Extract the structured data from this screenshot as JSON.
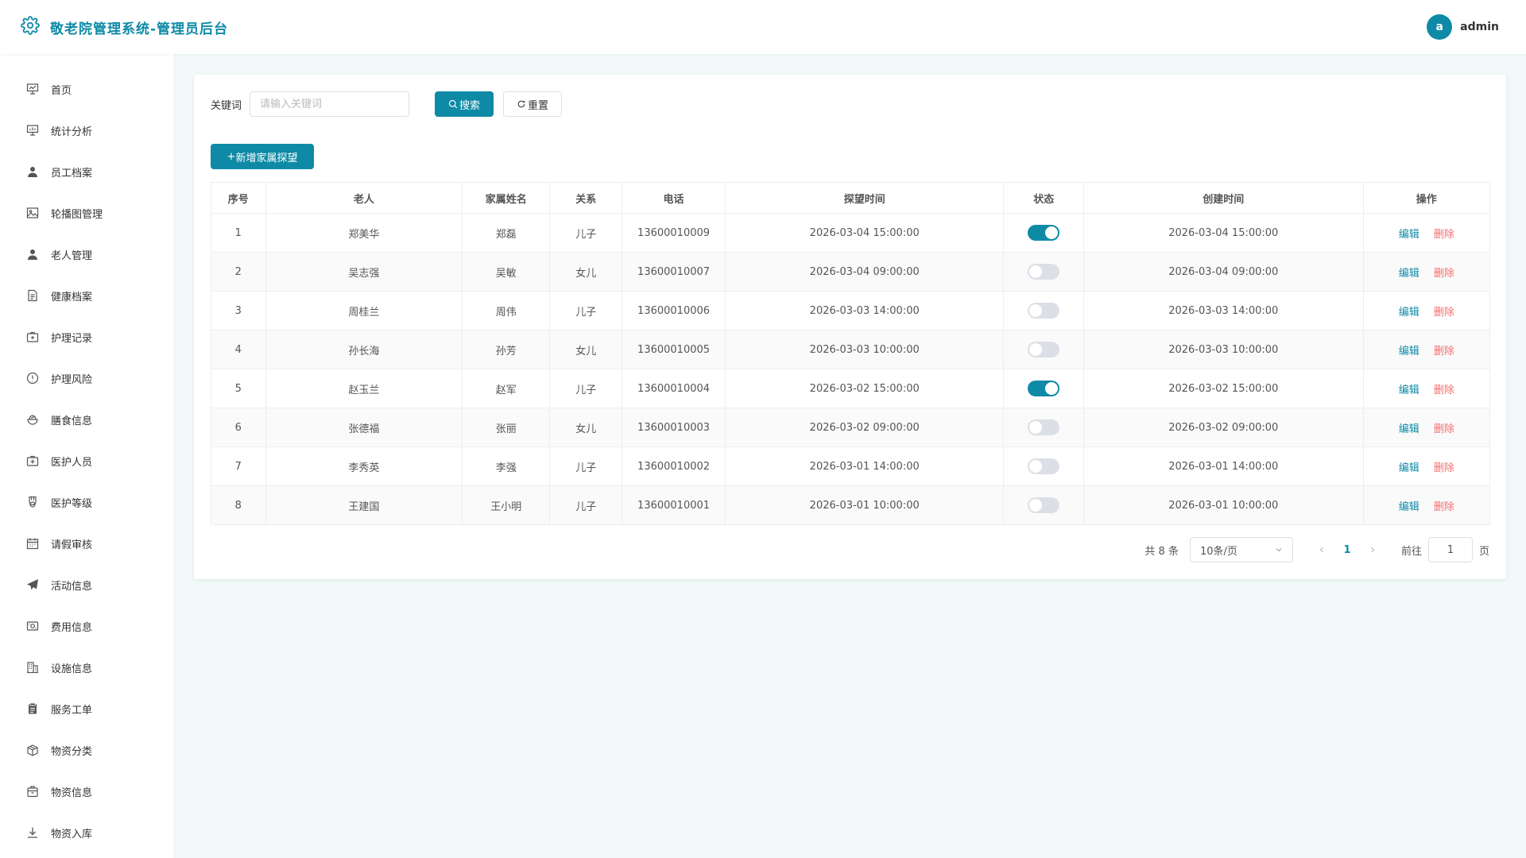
{
  "header": {
    "title": "敬老院管理系统-管理员后台",
    "avatar_letter": "a",
    "username": "admin"
  },
  "sidebar": {
    "items": [
      {
        "label": "首页",
        "icon": "presentation-icon"
      },
      {
        "label": "统计分析",
        "icon": "chart-board-icon"
      },
      {
        "label": "员工档案",
        "icon": "user-icon"
      },
      {
        "label": "轮播图管理",
        "icon": "image-icon"
      },
      {
        "label": "老人管理",
        "icon": "user-icon"
      },
      {
        "label": "健康档案",
        "icon": "document-icon"
      },
      {
        "label": "护理记录",
        "icon": "medical-box-icon"
      },
      {
        "label": "护理风险",
        "icon": "warning-circle-icon"
      },
      {
        "label": "膳食信息",
        "icon": "food-bowl-icon"
      },
      {
        "label": "医护人员",
        "icon": "first-aid-icon"
      },
      {
        "label": "医护等级",
        "icon": "medal-icon"
      },
      {
        "label": "请假审核",
        "icon": "calendar-icon"
      },
      {
        "label": "活动信息",
        "icon": "send-icon"
      },
      {
        "label": "费用信息",
        "icon": "money-icon"
      },
      {
        "label": "设施信息",
        "icon": "building-icon"
      },
      {
        "label": "服务工单",
        "icon": "clipboard-icon"
      },
      {
        "label": "物资分类",
        "icon": "box-icon"
      },
      {
        "label": "物资信息",
        "icon": "package-icon"
      },
      {
        "label": "物资入库",
        "icon": "download-icon"
      }
    ]
  },
  "search": {
    "label": "关键词",
    "placeholder": "请输入关键词",
    "search_btn": "搜索",
    "reset_btn": "重置"
  },
  "add_btn": "新增家属探望",
  "table": {
    "headers": [
      "序号",
      "老人",
      "家属姓名",
      "关系",
      "电话",
      "探望时间",
      "状态",
      "创建时间",
      "操作"
    ],
    "rows": [
      {
        "no": "1",
        "elder": "郑美华",
        "family": "郑磊",
        "relation": "儿子",
        "phone": "13600010009",
        "visit_time": "2026-03-04 15:00:00",
        "status": true,
        "created": "2026-03-04 15:00:00"
      },
      {
        "no": "2",
        "elder": "吴志强",
        "family": "吴敏",
        "relation": "女儿",
        "phone": "13600010007",
        "visit_time": "2026-03-04 09:00:00",
        "status": false,
        "created": "2026-03-04 09:00:00"
      },
      {
        "no": "3",
        "elder": "周桂兰",
        "family": "周伟",
        "relation": "儿子",
        "phone": "13600010006",
        "visit_time": "2026-03-03 14:00:00",
        "status": false,
        "created": "2026-03-03 14:00:00"
      },
      {
        "no": "4",
        "elder": "孙长海",
        "family": "孙芳",
        "relation": "女儿",
        "phone": "13600010005",
        "visit_time": "2026-03-03 10:00:00",
        "status": false,
        "created": "2026-03-03 10:00:00"
      },
      {
        "no": "5",
        "elder": "赵玉兰",
        "family": "赵军",
        "relation": "儿子",
        "phone": "13600010004",
        "visit_time": "2026-03-02 15:00:00",
        "status": true,
        "created": "2026-03-02 15:00:00"
      },
      {
        "no": "6",
        "elder": "张德福",
        "family": "张丽",
        "relation": "女儿",
        "phone": "13600010003",
        "visit_time": "2026-03-02 09:00:00",
        "status": false,
        "created": "2026-03-02 09:00:00"
      },
      {
        "no": "7",
        "elder": "李秀英",
        "family": "李强",
        "relation": "儿子",
        "phone": "13600010002",
        "visit_time": "2026-03-01 14:00:00",
        "status": false,
        "created": "2026-03-01 14:00:00"
      },
      {
        "no": "8",
        "elder": "王建国",
        "family": "王小明",
        "relation": "儿子",
        "phone": "13600010001",
        "visit_time": "2026-03-01 10:00:00",
        "status": false,
        "created": "2026-03-01 10:00:00"
      }
    ],
    "edit_label": "编辑",
    "delete_label": "删除"
  },
  "pagination": {
    "total": "共 8 条",
    "page_size": "10条/页",
    "current_page": "1",
    "goto_label": "前往",
    "goto_value": "1",
    "goto_suffix": "页"
  },
  "colors": {
    "primary": "#0e8aa6",
    "danger": "#f56c6c",
    "background": "#f1faf9"
  }
}
